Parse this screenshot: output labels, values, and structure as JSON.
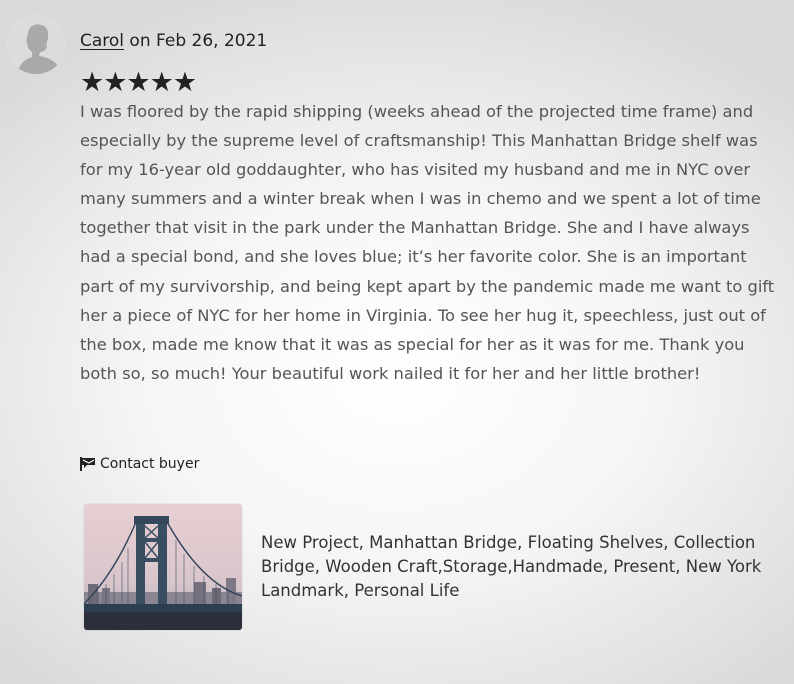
{
  "review": {
    "reviewer_name": "Carol",
    "date_text": " on Feb 26, 2021",
    "rating": 5,
    "rating_max": 5,
    "stars_text": "★★★★★",
    "text": "I was floored by the rapid shipping (weeks ahead of the projected time frame) and especially by the supreme level of craftsmanship! This Manhattan Bridge shelf was for my 16-year old goddaughter, who has visited my husband and me in NYC over many summers and a winter break when I was in chemo and we spent a lot of time together that visit in the park under the Manhattan Bridge. She and I have always had a special bond, and she loves blue; it’s her favorite color. She is an important part of my survivorship, and being kept apart by the pandemic made me want to gift her a piece of NYC for her home in Virginia. To see her hug it, speechless, just out of the box, made me know that it was as special for her as it was for me. Thank you both so, so much! Your beautiful work nailed it for her and her little brother!"
  },
  "contact": {
    "label": "Contact buyer",
    "icon": "message-flag-icon"
  },
  "listing": {
    "title": "New Project, Manhattan Bridge, Floating Shelves, Collection Bridge, Wooden Craft,Storage,Handmade, Present, New York Landmark, Personal Life",
    "thumbnail": "manhattan-bridge-photo"
  },
  "colors": {
    "text_primary": "#222222",
    "text_body": "#555555",
    "avatar_bg": "#dcdcdc",
    "avatar_figure": "#a9a9a9"
  }
}
